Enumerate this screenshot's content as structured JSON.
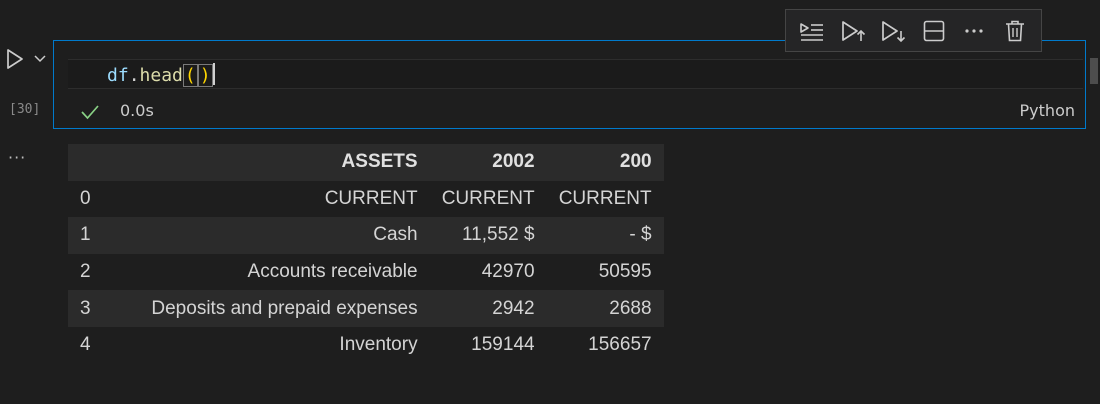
{
  "cell": {
    "execution_count": "[30]",
    "code": {
      "object": "df",
      "dot": ".",
      "method": "head",
      "open_paren": "(",
      "close_paren": ")"
    },
    "status": {
      "icon": "check-icon",
      "state": "success",
      "duration": "0.0s"
    },
    "language": "Python",
    "more_output": "···"
  },
  "toolbar": {
    "buttons": [
      {
        "name": "run-by-line",
        "icon": "run-by-line-icon"
      },
      {
        "name": "execute-above",
        "icon": "execute-above-icon"
      },
      {
        "name": "execute-below",
        "icon": "execute-below-icon"
      },
      {
        "name": "split-cell",
        "icon": "split-cell-icon"
      },
      {
        "name": "more-actions",
        "icon": "ellipsis-icon"
      },
      {
        "name": "delete-cell",
        "icon": "trash-icon"
      }
    ]
  },
  "output_table": {
    "columns": [
      "ASSETS",
      "2002",
      "200"
    ],
    "rows": [
      {
        "index": "0",
        "cells": [
          "CURRENT",
          "CURRENT",
          "CURRENT"
        ]
      },
      {
        "index": "1",
        "cells": [
          "Cash",
          "11,552 $",
          "- $"
        ]
      },
      {
        "index": "2",
        "cells": [
          "Accounts receivable",
          "42970",
          "50595"
        ]
      },
      {
        "index": "3",
        "cells": [
          "Deposits and prepaid expenses",
          "2942",
          "2688"
        ]
      },
      {
        "index": "4",
        "cells": [
          "Inventory",
          "159144",
          "156657"
        ]
      }
    ]
  },
  "colors": {
    "background": "#1e1e1e",
    "cell_border_focus": "#007acc",
    "success": "#89d185",
    "string_paren": "#ffd700",
    "identifier": "#9cdcfe",
    "function": "#dcdcaa"
  }
}
